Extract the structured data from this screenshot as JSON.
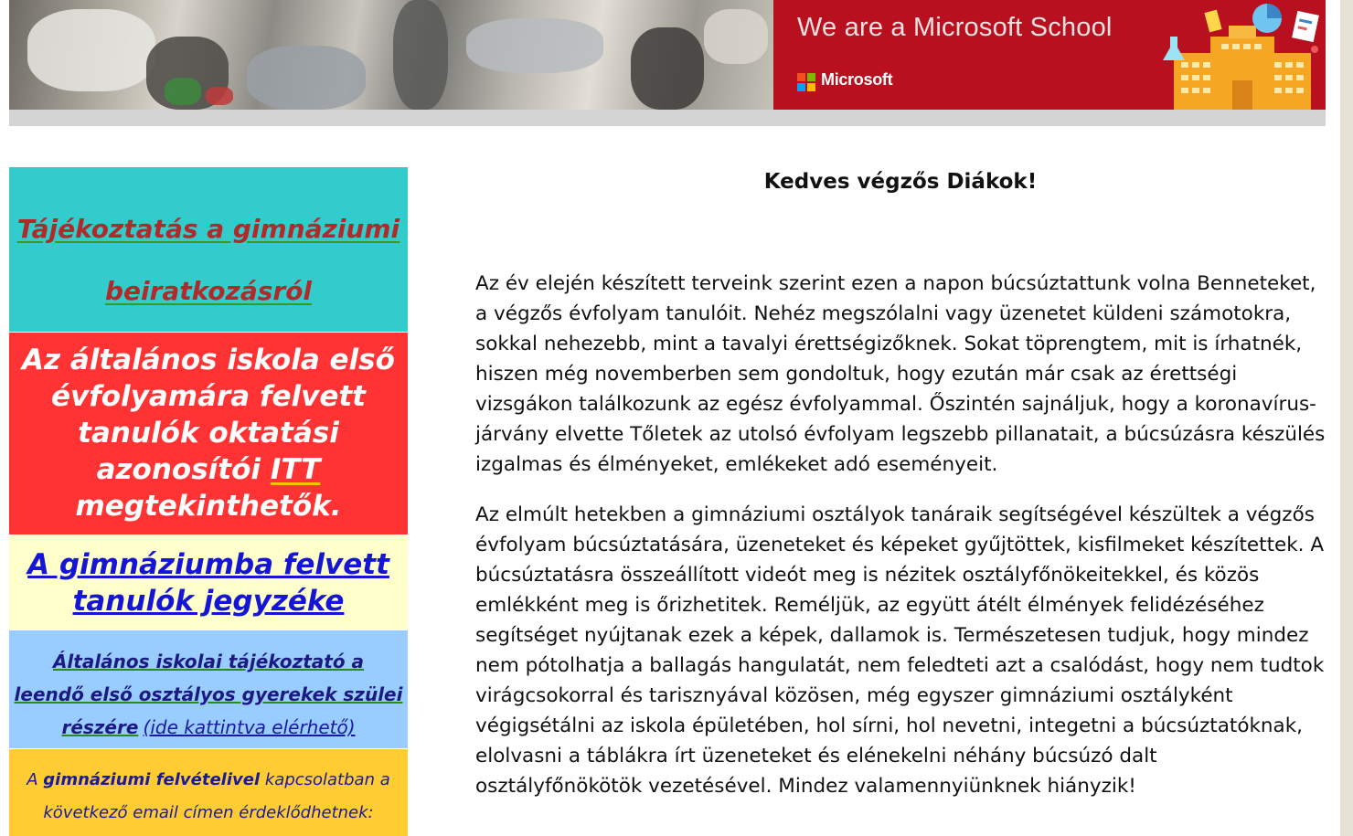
{
  "banner": {
    "title": "We are a Microsoft School",
    "brand": "Microsoft",
    "brand_colors": [
      "#f25022",
      "#7fba00",
      "#00a4ef",
      "#ffb900"
    ],
    "bg_color": "#b8101e"
  },
  "sidebar": {
    "box1": {
      "line1": "Tájékoztatás a gimnáziumi",
      "line2": "beiratkozásról",
      "bg": "#33cccc"
    },
    "box2": {
      "lines": [
        "Az általános iskola első",
        "évfolyamára felvett",
        "tanulók oktatási",
        "azonosítói "
      ],
      "itt": "ITT",
      "last": "megtekinthetők.",
      "bg": "#ff3333"
    },
    "box3": {
      "line1": "A gimnáziumba felvett",
      "line2": "tanulók jegyzéke",
      "bg": "#ffffcc"
    },
    "box4": {
      "line1": "Általános iskolai tájékoztató a",
      "line2": "leendő első osztályos gyerekek szülei",
      "line3": "részére",
      "sub": "(ide kattintva elérhető)",
      "bg": "#99ccff"
    },
    "box5": {
      "pre": "A ",
      "bold": "gimnáziumi felvételivel",
      "post": " kapcsolatban a",
      "line2": "következő email címen érdeklődhetnek:",
      "bg": "#ffcc33"
    }
  },
  "main": {
    "heading": "Kedves végzős Diákok!",
    "paragraphs": [
      "Az év elején készített terveink szerint ezen a napon búcsúztattunk volna Benneteket, a végzős évfolyam tanulóit. Nehéz megszólalni vagy üzenetet küldeni számotokra, sokkal nehezebb, mint a tavalyi érettségizőknek. Sokat töprengtem, mit is írhatnék, hiszen még novemberben sem gondoltuk, hogy ezután már csak az érettségi vizsgákon találkozunk az egész évfolyammal. Őszintén sajnáljuk, hogy a koronavírus-járvány elvette Tőletek az utolsó évfolyam legszebb pillanatait, a búcsúzásra készülés izgalmas és élményeket, emlékeket adó eseményeit.",
      "Az elmúlt hetekben a gimnáziumi osztályok tanáraik segítségével készültek a végzős évfolyam búcsúztatására, üzeneteket és képeket gyűjtöttek, kisfilmeket készítettek. A búcsúztatásra összeállított videót meg is nézitek osztályfőnökeitekkel, és közös emlékként meg is őrizhetitek. Reméljük, az együtt átélt élmények felidézéséhez segítséget nyújtanak ezek a képek, dallamok is. Természetesen tudjuk, hogy mindez nem pótolhatja a ballagás hangulatát, nem feledteti azt a csalódást, hogy nem tudtok virágcsokorral és tarisznyával közösen, még egyszer gimnáziumi osztályként végigsétálni az iskola épületében, hol sírni, hol nevetni, integetni a búcsúztatóknak, elolvasni a táblákra írt üzeneteket és elénekelni néhány búcsúzó dalt osztályfőnökötök vezetésével. Mindez valamennyiünknek hiányzik!"
    ]
  }
}
